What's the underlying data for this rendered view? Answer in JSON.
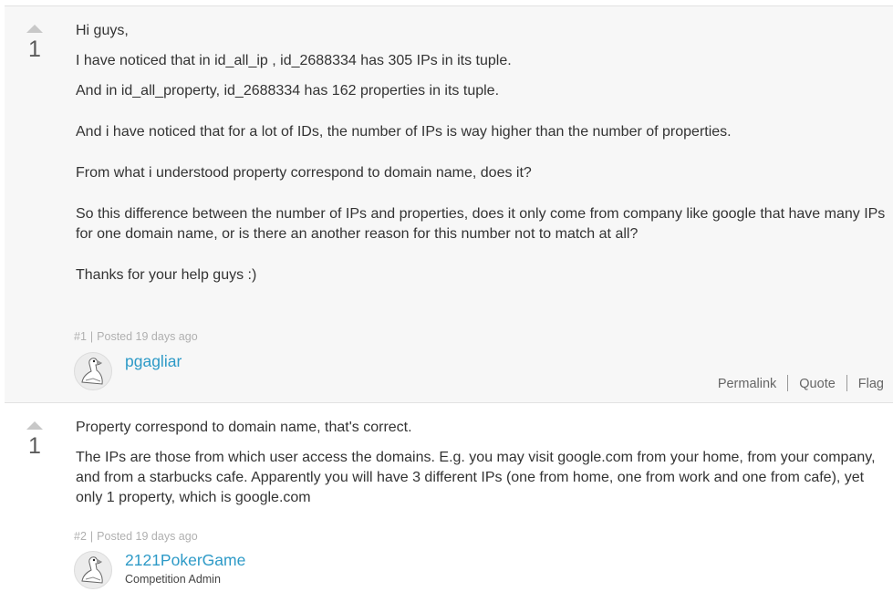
{
  "posts": [
    {
      "votes": "1",
      "paragraphs": [
        "Hi guys,",
        "I have noticed that in id_all_ip , id_2688334 has 305 IPs in its tuple.",
        "And in id_all_property, id_2688334 has 162 properties in its tuple.",
        "And i have noticed that for a lot of IDs, the number of IPs is way higher than the number of properties.",
        "From what i understood property correspond to domain name, does it?",
        "So this difference between the number of IPs and properties, does it only come from company like google that have many IPs for one domain name, or is there an another reason for this number not to match at all?",
        "Thanks for your help guys :)"
      ],
      "post_number": "#1",
      "posted": "Posted 19 days ago",
      "author": "pgagliar",
      "actions": {
        "permalink": "Permalink",
        "quote": "Quote",
        "flag": "Flag"
      }
    },
    {
      "votes": "1",
      "paragraphs": [
        "Property correspond to domain name, that's correct.",
        "The IPs are those from which user access the domains. E.g. you may visit google.com from your home, from your company, and from a starbucks cafe.  Apparently you will have 3 different IPs (one from home, one from work and one from cafe), yet only 1 property, which is google.com"
      ],
      "post_number": "#2",
      "posted": "Posted 19 days ago",
      "author": "2121PokerGame",
      "author_role": "Competition Admin"
    }
  ],
  "icons": {
    "vote_up": "triangle-up-icon",
    "avatar": "goose-avatar-icon"
  },
  "colors": {
    "link": "#2d9ac7",
    "post_background": "#f7f7f7",
    "meta_text": "#b0b0b0"
  }
}
